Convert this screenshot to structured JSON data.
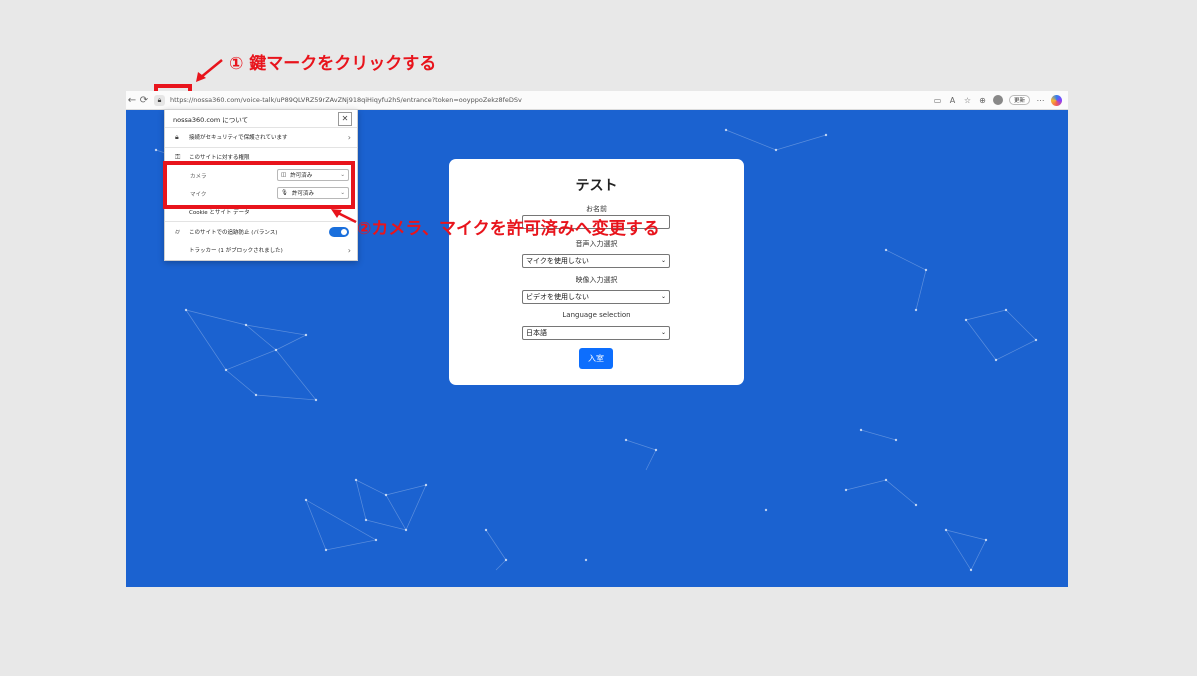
{
  "annotations": {
    "step1": "① 鍵マークをクリックする",
    "step2": "②カメラ、マイクを許可済みへ変更する",
    "color": "#e8141c"
  },
  "browser": {
    "url": "https://nossa360.com/voice-talk/uP89QLVRZ59rZAvZNj918qiHiqyfu2hS/entrance?token=ooyppoZekz8feDSv",
    "update_label": "更新",
    "icons": [
      "back-icon",
      "refresh-icon",
      "lock-icon",
      "camera-icon",
      "read-aloud-icon",
      "favorite-icon",
      "collections-icon",
      "profile-avatar",
      "more-icon",
      "copilot-icon"
    ]
  },
  "site_info_popup": {
    "title": "nossa360.com について",
    "connection": "接続がセキュリティで保護されています",
    "permissions_header": "このサイトに対する権限",
    "permissions": [
      {
        "label": "カメラ",
        "value": "許可済み"
      },
      {
        "label": "マイク",
        "value": "許可済み"
      }
    ],
    "cookies": "Cookie とサイト データ",
    "tracking_prevention": "このサイトでの追跡防止 (バランス)",
    "trackers": "トラッカー (1 がブロックされました)"
  },
  "form": {
    "title": "テスト",
    "name_label": "お名前",
    "name_value": "",
    "audio_label": "音声入力選択",
    "audio_value": "マイクを使用しない",
    "video_label": "映像入力選択",
    "video_value": "ビデオを使用しない",
    "lang_label": "Language selection",
    "lang_value": "日本語",
    "enter_button": "入室"
  },
  "colors": {
    "background": "#1b62d0",
    "primary_button": "#0d6efd",
    "annotation": "#e8141c"
  }
}
